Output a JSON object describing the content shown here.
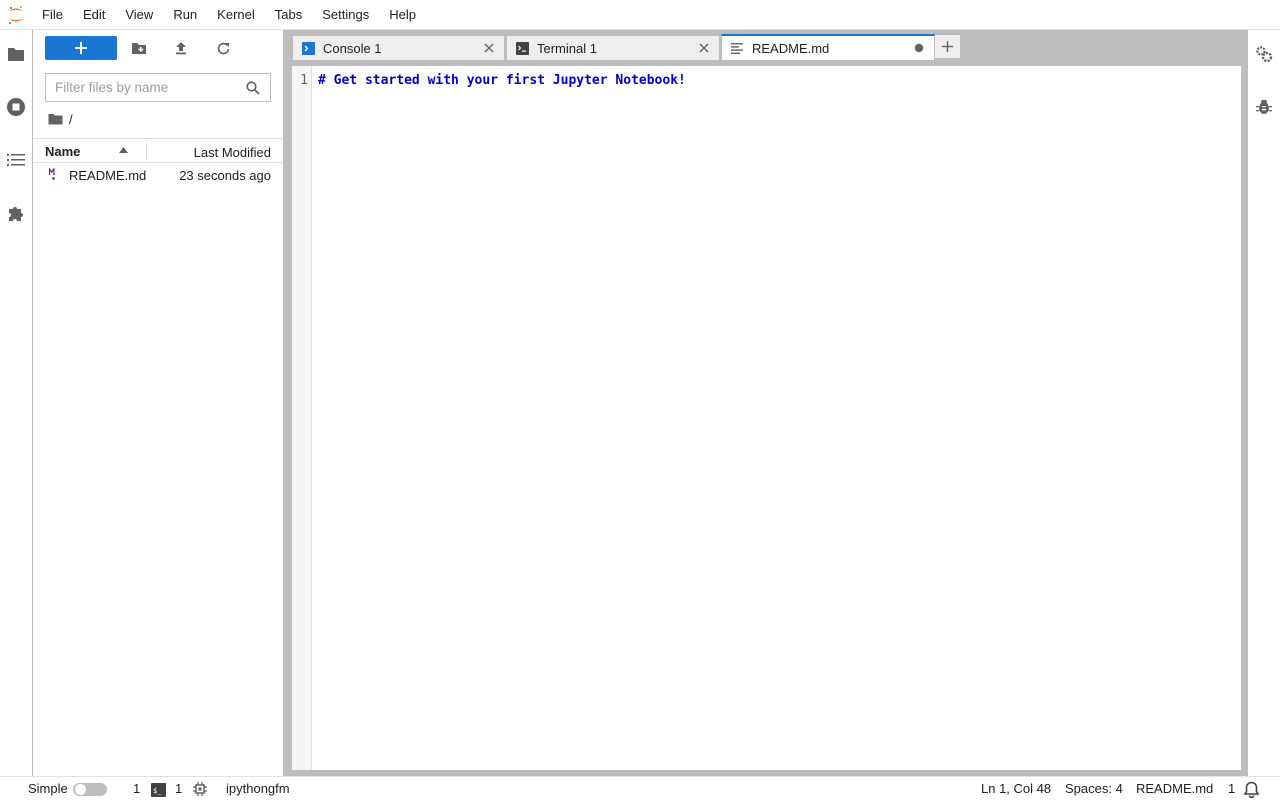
{
  "menu": {
    "items": [
      "File",
      "Edit",
      "View",
      "Run",
      "Kernel",
      "Tabs",
      "Settings",
      "Help"
    ]
  },
  "left_sidebar": {
    "icons": [
      "folder-icon",
      "running-stop-icon",
      "table-of-contents-icon",
      "extension-puzzle-icon"
    ]
  },
  "filebrowser": {
    "new_label": "+",
    "filter_placeholder": "Filter files by name",
    "filter_value": "",
    "breadcrumb": "/",
    "columns": {
      "name": "Name",
      "modified": "Last Modified"
    },
    "files": [
      {
        "name": "README.md",
        "modified": "23 seconds ago",
        "icon": "markdown-icon"
      }
    ]
  },
  "tabs": [
    {
      "label": "Console 1",
      "icon": "console-icon",
      "active": false
    },
    {
      "label": "Terminal 1",
      "icon": "terminal-icon",
      "active": false
    },
    {
      "label": "README.md",
      "icon": "text-file-icon",
      "active": true,
      "modified": true
    }
  ],
  "editor": {
    "line_number": "1",
    "content": "# Get started with your first Jupyter Notebook!"
  },
  "statusbar": {
    "mode_label": "Simple",
    "kernel_count": "1",
    "terminal_count": "1",
    "kernel_name": "ipythongfm",
    "cursor": "Ln 1, Col 48",
    "spaces": "Spaces: 4",
    "filename": "README.md",
    "notifications": "1"
  },
  "colors": {
    "accent": "#1976d2",
    "jupyter_orange": "#f37726",
    "markdown_purple": "#7b1fa2"
  }
}
